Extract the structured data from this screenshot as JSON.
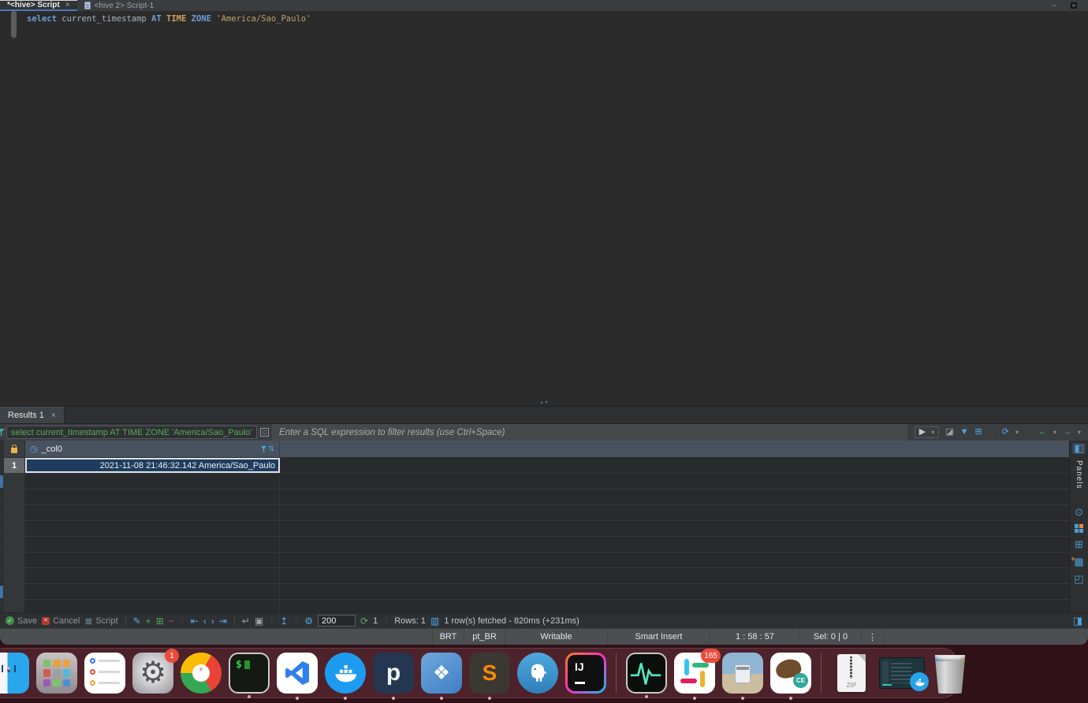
{
  "editor": {
    "tabs": {
      "active": "*<hive> Script",
      "inactive": "<hive 2> Script-1"
    },
    "code": [
      {
        "t": "select"
      },
      {
        "t": " current_timestamp "
      },
      {
        "t": "AT"
      },
      {
        "t": " "
      },
      {
        "t": "TIME"
      },
      {
        "t": " "
      },
      {
        "t": "ZONE"
      },
      {
        "t": " "
      },
      {
        "t": "'America/Sao_Paulo'"
      }
    ]
  },
  "results": {
    "tab_label": "Results 1",
    "filter_query": "select current_timestamp AT TIME ZONE 'America/Sao_Paulo'",
    "filter_placeholder": "Enter a SQL expression to filter results (use Ctrl+Space)",
    "grid": {
      "column": "_col0",
      "rows": [
        {
          "num": "1",
          "value": "2021-11-08 21:46:32.142 America/Sao_Paulo"
        }
      ]
    },
    "panels_label": "Panels"
  },
  "toolbar": {
    "save": "Save",
    "cancel": "Cancel",
    "script": "Script",
    "fetch_size": "200",
    "refresh_count": "1",
    "rows_label": "Rows: 1",
    "fetch_status": "1 row(s) fetched - 820ms (+231ms)"
  },
  "statusbar": {
    "timezone": "BRT",
    "locale": "pt_BR",
    "writable": "Writable",
    "insert_mode": "Smart Insert",
    "caret_position": "1 : 58 : 57",
    "selection": "Sel: 0 | 0",
    "overflow_menu": "⋮"
  },
  "dock": {
    "badges": {
      "system_preferences": "1",
      "slack": "165"
    },
    "glyphs": {
      "terminal_prompt": "$",
      "p_app": "p",
      "aperture": "❖",
      "sublime": "S",
      "intellij": "IJ",
      "dbeaver_edition": "CE",
      "zip": "ZIP",
      "gear": "⚙"
    }
  },
  "icons": {
    "close": "×",
    "minimize": "–",
    "splitter_up": "▴",
    "splitter_down": "▾",
    "clock": "◷",
    "sort": "⇅",
    "play": "▶",
    "dropdown": "▾",
    "eraser": "◪",
    "funnel_small": "▼",
    "grid_save": "⊞",
    "refresh": "⟳",
    "back": "←",
    "forward": "→",
    "pencil": "✎",
    "add_row": "+",
    "dup_row": "⊞",
    "del_row": "−",
    "first": "⇤",
    "prev": "‹",
    "next": "›",
    "last": "⇥",
    "flip": "↵",
    "frame": "▣",
    "export": "↥",
    "gear": "⚙",
    "check": "✓",
    "cross": "✕",
    "script": "≣",
    "rows_stat": "▥",
    "dots": "⋮",
    "panel_toggle": "◨",
    "rs_panels": "◧",
    "rs_value": "⊙",
    "rs_calc": "⊞",
    "rs_meta": "▦",
    "rs_plus": "+",
    "rs_layout": "◰",
    "rs_switch": "↰"
  },
  "colors": {
    "accent_blue": "#4B9FD5",
    "keyword_blue": "#6C9ED4",
    "type_gold": "#CFA05A",
    "string_tan": "#BCA26D",
    "filter_green": "#57A857",
    "selection_bg": "#1E3C5F",
    "dock_bg": "#763C48",
    "desktop_bg": "#301118"
  }
}
